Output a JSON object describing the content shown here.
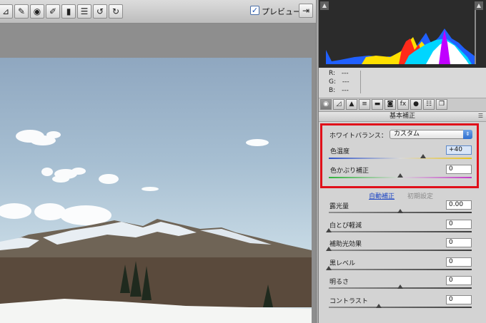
{
  "toolbar": {
    "tools": [
      {
        "icon": "straighten-tool-icon"
      },
      {
        "icon": "spot-removal-icon"
      },
      {
        "icon": "red-eye-icon"
      },
      {
        "icon": "adjustment-brush-icon"
      },
      {
        "icon": "graduated-filter-icon"
      },
      {
        "icon": "preferences-icon"
      },
      {
        "icon": "rotate-ccw-icon"
      },
      {
        "icon": "rotate-cw-icon"
      }
    ],
    "preview_label": "プレビュー",
    "preview_checked": "✓"
  },
  "rgb_readout": {
    "r_label": "R:",
    "r_value": "---",
    "g_label": "G:",
    "g_value": "---",
    "b_label": "B:",
    "b_value": "---"
  },
  "panel": {
    "section_title": "基本補正",
    "section_menu": "☰"
  },
  "white_balance": {
    "label": "ホワイトバランス：",
    "selected": "カスタム",
    "temperature_label": "色温度",
    "temperature_value": "+40",
    "temperature_level": 0.66,
    "tint_label": "色かぶり補正",
    "tint_value": "0",
    "tint_level": 0.5
  },
  "tone_links": {
    "auto": "自動補正",
    "default": "初期設定"
  },
  "adjustments": [
    {
      "label": "露光量",
      "value": "0.00",
      "level": 0.5
    },
    {
      "label": "白とび軽減",
      "value": "0",
      "level": 0.0
    },
    {
      "label": "補助光効果",
      "value": "0",
      "level": 0.0
    },
    {
      "label": "黒レベル",
      "value": "0",
      "level": 0.0
    },
    {
      "label": "明るさ",
      "value": "0",
      "level": 0.5
    },
    {
      "label": "コントラスト",
      "value": "0",
      "level": 0.35
    }
  ],
  "colors": {
    "highlight": "#e0101a",
    "link": "#1d46c4",
    "histogram_bg": "#2b2b2b"
  }
}
